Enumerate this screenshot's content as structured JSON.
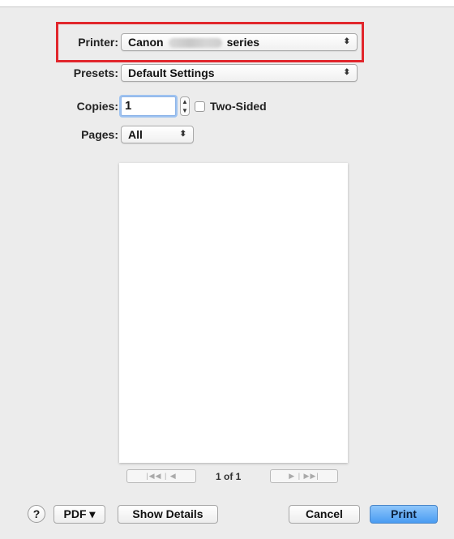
{
  "printer": {
    "label": "Printer:",
    "value_prefix": "Canon",
    "value_suffix": "series"
  },
  "presets": {
    "label": "Presets:",
    "value": "Default Settings"
  },
  "copies": {
    "label": "Copies:",
    "value": "1",
    "two_sided_label": "Two-Sided",
    "two_sided_checked": false
  },
  "pages": {
    "label": "Pages:",
    "value": "All"
  },
  "pager": {
    "text": "1 of 1",
    "first_prev": "|◀◀ | ◀",
    "next_last": "▶ | ▶▶|"
  },
  "footer": {
    "help": "?",
    "pdf": "PDF ▾",
    "show_details": "Show Details",
    "cancel": "Cancel",
    "print": "Print"
  },
  "icons": {
    "popup_arrows": "updown-arrows-icon",
    "stepper": "stepper-arrows-icon",
    "help": "question-icon"
  },
  "colors": {
    "highlight": "#e1262c",
    "primary_button": "#4a9cf2"
  }
}
